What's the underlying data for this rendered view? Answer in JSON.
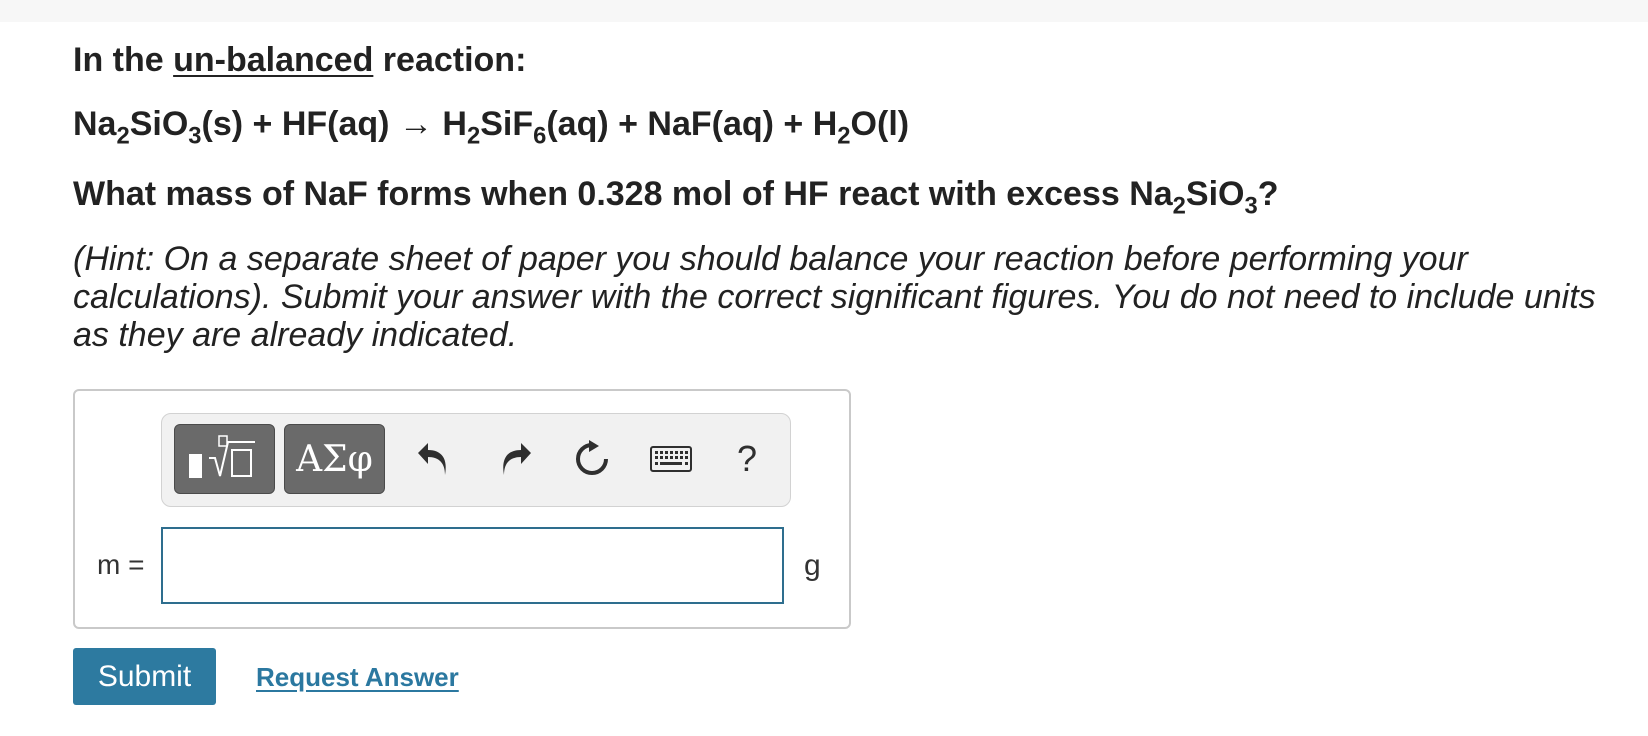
{
  "problem": {
    "intro_before": "In the ",
    "intro_underlined": "un-balanced",
    "intro_after": " reaction:",
    "equation": {
      "t1": "Na",
      "s1": "2",
      "t2": "SiO",
      "s2": "3",
      "t3": "(s) + HF(aq) → H",
      "s3": "2",
      "t4": "SiF",
      "s4": "6",
      "t5": "(aq) + NaF(aq) + H",
      "s5": "2",
      "t6": "O(l)"
    },
    "question": {
      "t1": "What mass of NaF forms when 0.328 mol of HF react with excess Na",
      "s1": "2",
      "t2": "SiO",
      "s2": "3",
      "t3": "?"
    },
    "hint": "(Hint: On a separate sheet of paper you should balance your reaction before performing your calculations). Submit your answer with the correct significant figures. You do not need to include units as they are already indicated."
  },
  "answer": {
    "variable_label": "m =",
    "unit": "g",
    "input_value": ""
  },
  "toolbar": {
    "symbols_label": "ΑΣφ",
    "help_label": "?",
    "icons": [
      "templates-icon",
      "undo-icon",
      "redo-icon",
      "reset-icon",
      "keyboard-icon",
      "help-icon"
    ]
  },
  "actions": {
    "submit_label": "Submit",
    "request_answer_label": "Request Answer"
  },
  "colors": {
    "submit_bg": "#2d7aa0",
    "link": "#2b78a0",
    "input_border": "#2e6e8e",
    "toolbar_button": "#6a6a6a"
  }
}
